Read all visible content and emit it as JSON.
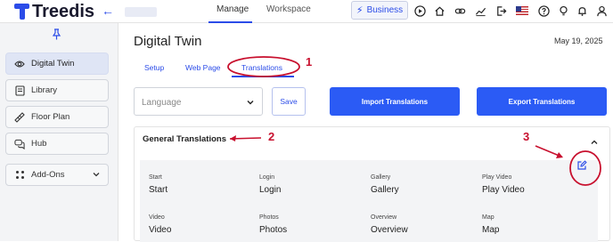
{
  "app": {
    "logo_text": "Treedis"
  },
  "topbar": {
    "tabs": [
      {
        "label": "Manage"
      },
      {
        "label": "Workspace"
      }
    ],
    "business_label": "Business",
    "icons": [
      "play-icon",
      "home-icon",
      "link-icon",
      "analytics-icon",
      "export-icon",
      "flag-us-icon",
      "help-icon",
      "bulb-icon",
      "bell-icon",
      "user-icon"
    ]
  },
  "sidebar": {
    "items": [
      {
        "label": "Digital Twin",
        "icon": "eye-icon"
      },
      {
        "label": "Library",
        "icon": "library-icon"
      },
      {
        "label": "Floor Plan",
        "icon": "ruler-icon"
      },
      {
        "label": "Hub",
        "icon": "chat-icon"
      },
      {
        "label": "Add-Ons",
        "icon": "grid-icon"
      }
    ]
  },
  "main": {
    "title": "Digital Twin",
    "date": "May 19, 2025",
    "subtabs": [
      {
        "label": "Setup"
      },
      {
        "label": "Web Page"
      },
      {
        "label": "Translations"
      }
    ],
    "language_placeholder": "Language",
    "save_label": "Save",
    "import_label": "Import Translations",
    "export_label": "Export Translations",
    "general": {
      "title": "General Translations",
      "rows": [
        [
          {
            "label": "Start",
            "value": "Start"
          },
          {
            "label": "Login",
            "value": "Login"
          },
          {
            "label": "Gallery",
            "value": "Gallery"
          },
          {
            "label": "Play Video",
            "value": "Play Video"
          }
        ],
        [
          {
            "label": "Video",
            "value": "Video"
          },
          {
            "label": "Photos",
            "value": "Photos"
          },
          {
            "label": "Overview",
            "value": "Overview"
          },
          {
            "label": "Map",
            "value": "Map"
          }
        ]
      ]
    }
  },
  "annotations": {
    "n1": "1",
    "n2": "2",
    "n3": "3"
  },
  "colors": {
    "accent": "#2b4ce8",
    "button": "#2b5bf5",
    "annotation": "#c8102e"
  }
}
